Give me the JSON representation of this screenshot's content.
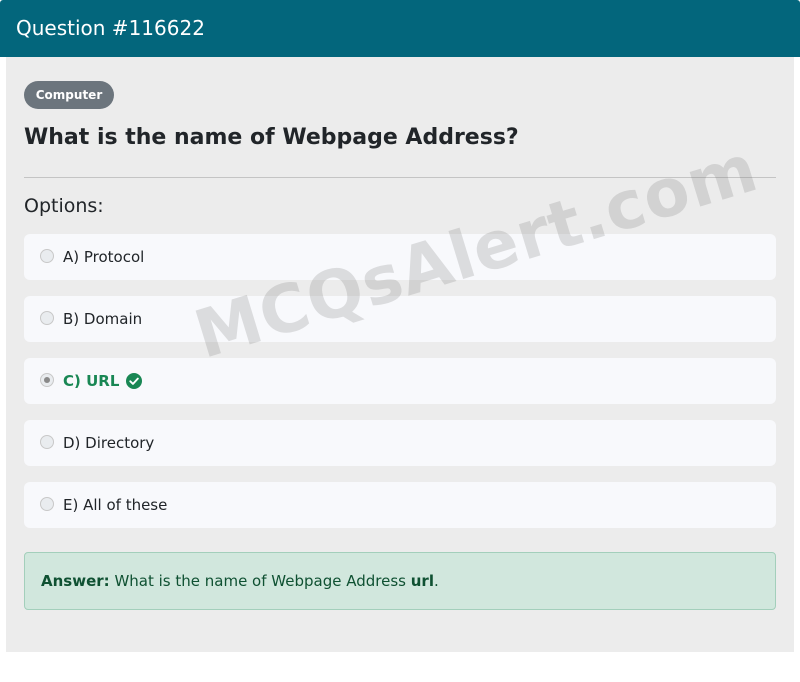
{
  "header": {
    "title": "Question #116622"
  },
  "category_badge": "Computer",
  "question": "What is the name of Webpage Address?",
  "options_label": "Options:",
  "options": [
    {
      "label": "A) Protocol",
      "selected": false,
      "correct": false
    },
    {
      "label": "B) Domain",
      "selected": false,
      "correct": false
    },
    {
      "label": "C) URL",
      "selected": true,
      "correct": true,
      "icon": "check-circle-icon"
    },
    {
      "label": "D) Directory",
      "selected": false,
      "correct": false
    },
    {
      "label": "E) All of these",
      "selected": false,
      "correct": false
    }
  ],
  "answer": {
    "prefix": "Answer:",
    "text": "What is the name of Webpage Address",
    "highlight": "url",
    "suffix": "."
  },
  "watermark": "MCQsAlert.com",
  "colors": {
    "header_bg": "#03667c",
    "correct": "#198754",
    "answer_bg": "#d1e7dd"
  }
}
